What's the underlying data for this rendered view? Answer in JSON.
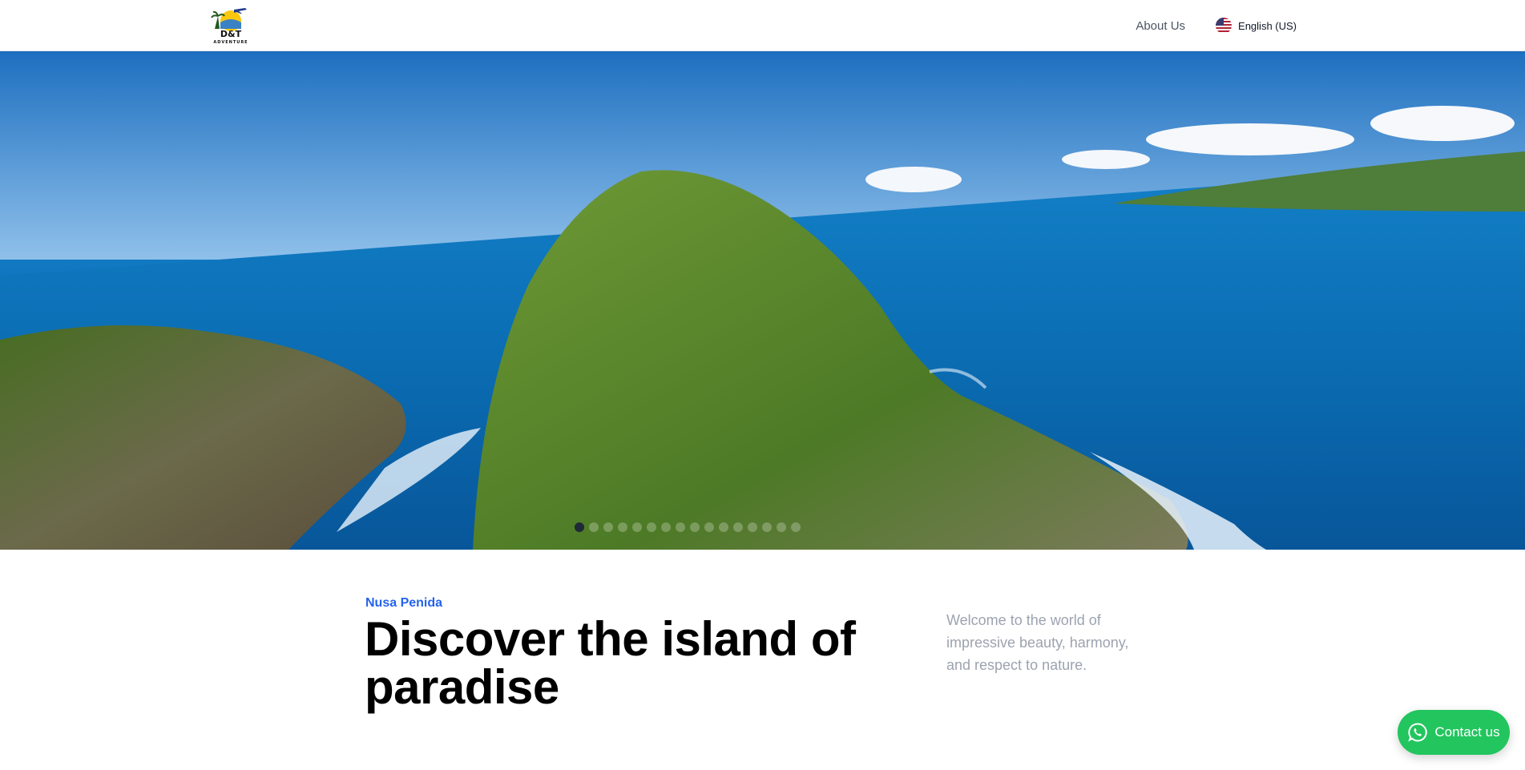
{
  "header": {
    "logo_alt": "D&T Adventure",
    "logo_text": "D&T",
    "logo_subtext": "ADVENTURE",
    "nav": {
      "about_label": "About Us",
      "language_label": "English (US)",
      "language_icon": "us-flag-icon"
    }
  },
  "hero": {
    "slides_count": 16,
    "active_slide": 1
  },
  "intro": {
    "subtitle": "Nusa Penida",
    "headline": "Discover the island of paradise",
    "description": "Welcome to the world of impressive beauty, harmony, and respect to nature."
  },
  "contact": {
    "label": "Contact us",
    "icon": "whatsapp-icon"
  },
  "colors": {
    "accent": "#2563eb",
    "whatsapp": "#22c55e",
    "muted_text": "#9ca3af"
  }
}
